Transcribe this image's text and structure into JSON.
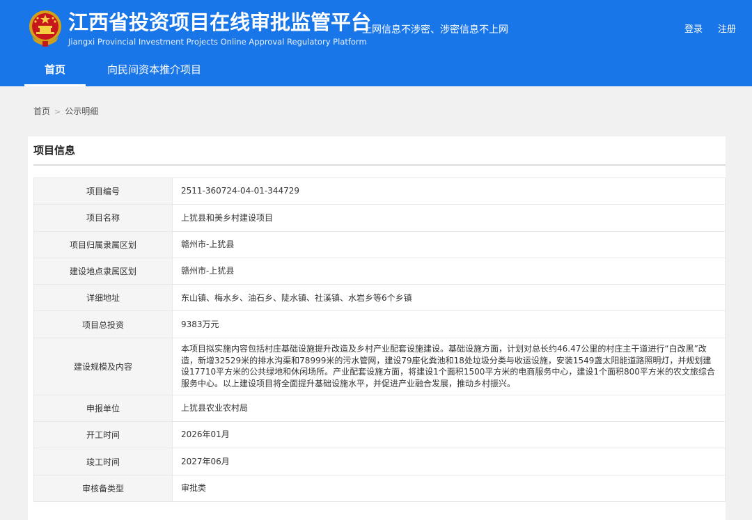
{
  "header": {
    "title": "江西省投资项目在线审批监管平台",
    "subtitle": "Jiangxi Provincial Investment Projects Online Approval Regulatory Platform",
    "slogan": "上网信息不涉密、涉密信息不上网",
    "login_label": "登录",
    "register_label": "注册",
    "accent_color": "#1976e8"
  },
  "nav": {
    "items": [
      {
        "label": "首页",
        "active": true
      },
      {
        "label": "向民间资本推介项目",
        "active": false
      }
    ]
  },
  "breadcrumb": {
    "home": "首页",
    "separator": ">",
    "current": "公示明细"
  },
  "panel": {
    "title": "项目信息",
    "rows": [
      {
        "label": "项目编号",
        "value": "2511-360724-04-01-344729"
      },
      {
        "label": "项目名称",
        "value": "上犹县和美乡村建设项目"
      },
      {
        "label": "项目归属隶属区划",
        "value": "赣州市-上犹县"
      },
      {
        "label": "建设地点隶属区划",
        "value": "赣州市-上犹县"
      },
      {
        "label": "详细地址",
        "value": "东山镇、梅水乡、油石乡、陡水镇、社溪镇、水岩乡等6个乡镇"
      },
      {
        "label": "项目总投资",
        "value": "9383万元"
      },
      {
        "label": "建设规模及内容",
        "value": "本项目拟实施内容包括村庄基础设施提升改造及乡村产业配套设施建设。基础设施方面，计划对总长约46.47公里的村庄主干道进行“白改黑”改造，新增32529米的排水沟渠和78999米的污水管网，建设79座化粪池和18处垃圾分类与收运设施，安装1549盏太阳能道路照明灯，并规划建设17710平方米的公共绿地和休闲场所。产业配套设施方面，将建设1个面积1500平方米的电商服务中心，建设1个面积800平方米的农文旅综合服务中心。以上建设项目将全面提升基础设施水平，并促进产业融合发展，推动乡村振兴。"
      },
      {
        "label": "申报单位",
        "value": "上犹县农业农村局"
      },
      {
        "label": "开工时间",
        "value": "2026年01月"
      },
      {
        "label": "竣工时间",
        "value": "2027年06月"
      },
      {
        "label": "审核备类型",
        "value": "审批类"
      }
    ]
  }
}
